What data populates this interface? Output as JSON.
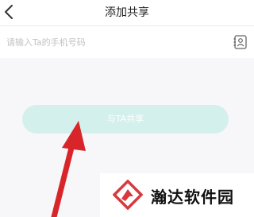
{
  "header": {
    "title": "添加共享",
    "back_icon": "back-arrow-icon"
  },
  "phone": {
    "placeholder": "请输入Ta的手机号码",
    "value": "",
    "contact_icon": "contact-book-icon"
  },
  "share_button": {
    "label": "与TA共享"
  },
  "watermark": {
    "text": "瀚达软件园",
    "logo_icon": "watermark-logo-icon"
  },
  "colors": {
    "accent": "#d4f0ed",
    "arrow": "#d8252a",
    "logo": "#d9383d"
  }
}
